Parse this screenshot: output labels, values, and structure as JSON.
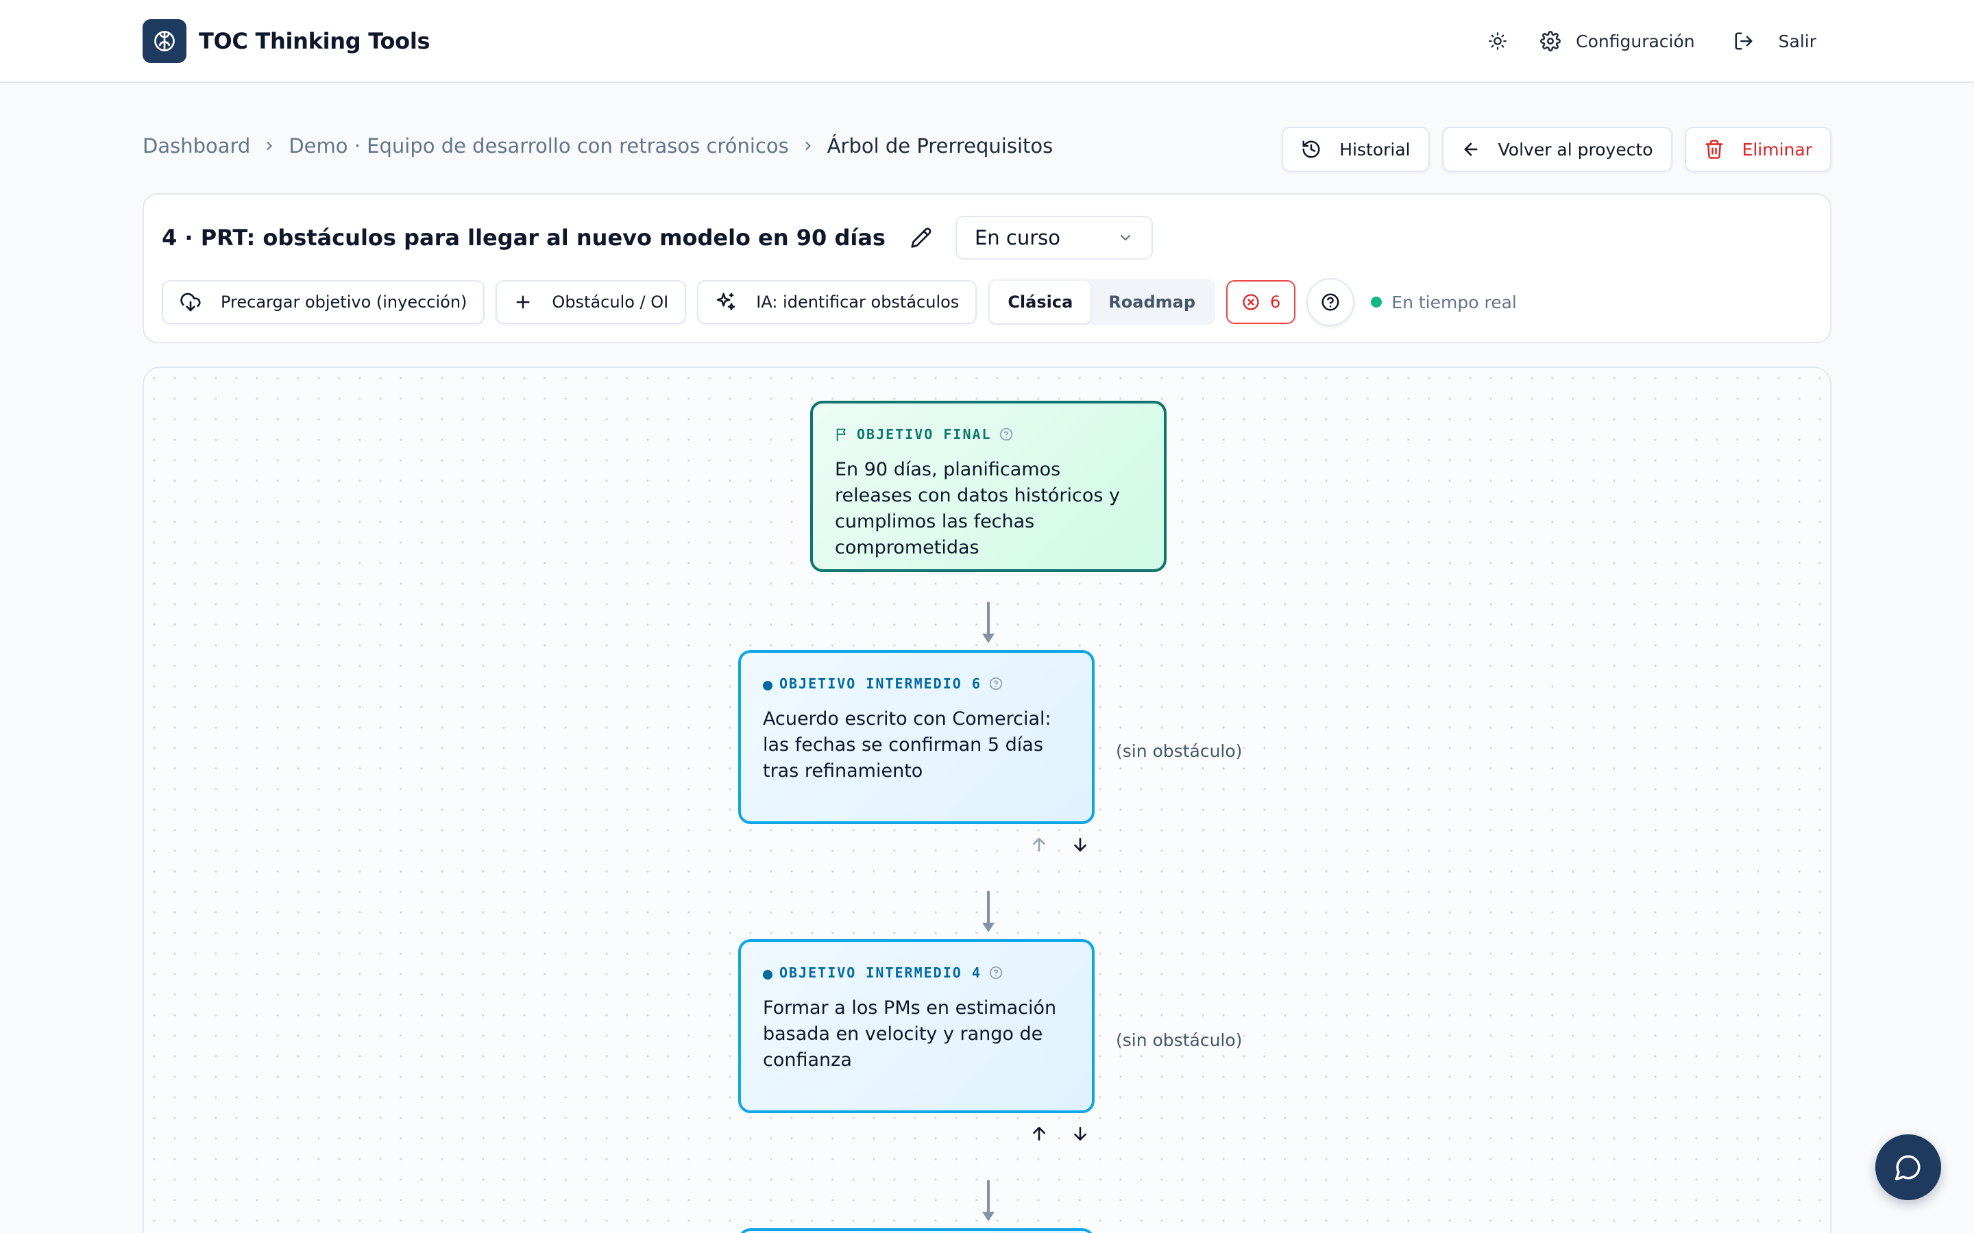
{
  "app": {
    "name": "TOC Thinking Tools"
  },
  "nav": {
    "settings_label": "Configuración",
    "logout_label": "Salir"
  },
  "breadcrumb": [
    "Dashboard",
    "Demo · Equipo de desarrollo con retrasos crónicos",
    "Árbol de Prerrequisitos"
  ],
  "actions": {
    "history": "Historial",
    "back": "Volver al proyecto",
    "delete": "Eliminar"
  },
  "document": {
    "title": "4 · PRT: obstáculos para llegar al nuevo modelo en 90 días",
    "status": "En curso"
  },
  "toolbar": {
    "preload": "Precargar objetivo (inyección)",
    "add": "Obstáculo / OI",
    "ai": "IA: identificar obstáculos",
    "view_classic": "Clásica",
    "view_roadmap": "Roadmap",
    "error_count": "6",
    "realtime": "En tiempo real"
  },
  "tree": {
    "goal": {
      "label": "OBJETIVO FINAL",
      "text": "En 90 días, planificamos releases con datos históricos y cumplimos las fechas comprometidas"
    },
    "intermediate": [
      {
        "label": "OBJETIVO INTERMEDIO 6",
        "text": "Acuerdo escrito con Comercial: las fechas se confirman 5 días tras refinamiento",
        "obstacle": "(sin obstáculo)"
      },
      {
        "label": "OBJETIVO INTERMEDIO 4",
        "text": "Formar a los PMs en estimación basada en velocity y rango de confianza",
        "obstacle": "(sin obstáculo)"
      }
    ]
  },
  "colors": {
    "brand": "#1e3a5f",
    "goal_border": "#0f766e",
    "io_border": "#0ea5e9",
    "danger": "#dc2626",
    "live": "#10b981"
  }
}
